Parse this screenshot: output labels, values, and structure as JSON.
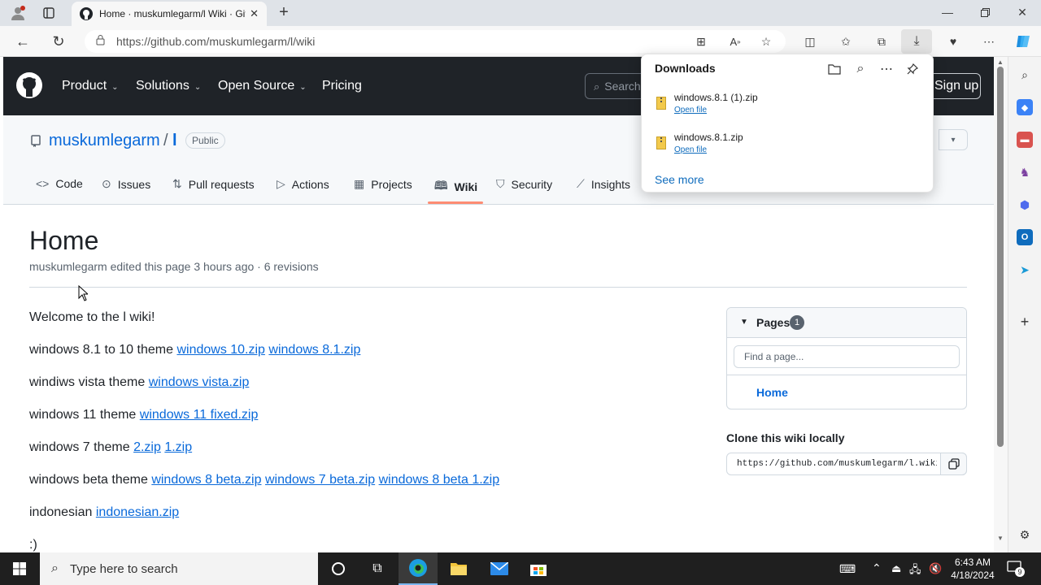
{
  "browser": {
    "tab_title": "Home · muskumlegarm/l Wiki · GitHub",
    "url": "https://github.com/muskumlegarm/l/wiki"
  },
  "github_nav": {
    "items": [
      "Product",
      "Solutions",
      "Open Source",
      "Pricing"
    ],
    "search_placeholder": "Search",
    "signup": "Sign up"
  },
  "repo": {
    "owner": "muskumlegarm",
    "slash": "/",
    "name": "l",
    "visibility": "Public",
    "tabs": [
      "Code",
      "Issues",
      "Pull requests",
      "Actions",
      "Projects",
      "Wiki",
      "Security",
      "Insights"
    ]
  },
  "page": {
    "title": "Home",
    "meta": "muskumlegarm edited this page 3 hours ago · 6 revisions",
    "welcome": "Welcome to the l wiki!",
    "lines": [
      {
        "text": "windows 8.1 to 10 theme",
        "links": [
          "windows 10.zip",
          "windows 8.1.zip"
        ]
      },
      {
        "text": "windiws vista theme",
        "links": [
          "windows vista.zip"
        ]
      },
      {
        "text": "windows 11 theme",
        "links": [
          "windows 11 fixed.zip"
        ]
      },
      {
        "text": "windows 7 theme",
        "links": [
          "2.zip",
          "1.zip"
        ]
      },
      {
        "text": "windows beta theme",
        "links": [
          "windows 8 beta.zip",
          "windows 7 beta.zip",
          "windows 8 beta 1.zip"
        ]
      },
      {
        "text": "indonesian",
        "links": [
          "indonesian.zip"
        ]
      }
    ],
    "last_line": ":)"
  },
  "sidebar": {
    "pages_label": "Pages",
    "pages_count": "1",
    "find_placeholder": "Find a page...",
    "page_item": "Home",
    "clone_title": "Clone this wiki locally",
    "clone_url": "https://github.com/muskumlegarm/l.wiki.git"
  },
  "downloads": {
    "title": "Downloads",
    "items": [
      {
        "name": "windows.8.1 (1).zip",
        "action": "Open file"
      },
      {
        "name": "windows.8.1.zip",
        "action": "Open file"
      }
    ],
    "see_more": "See more"
  },
  "taskbar": {
    "search_placeholder": "Type here to search",
    "time": "6:43 AM",
    "date": "4/18/2024",
    "notification_count": "9"
  }
}
